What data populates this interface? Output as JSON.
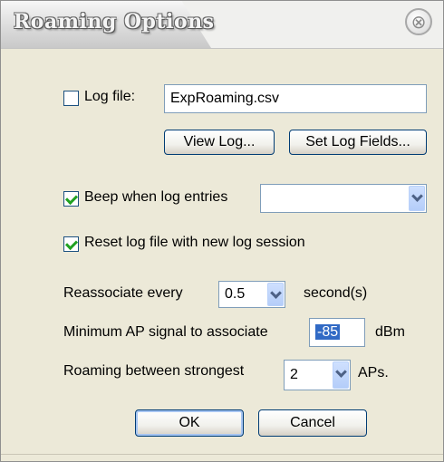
{
  "window": {
    "title": "Roaming Options",
    "close_glyph": "⊗"
  },
  "log": {
    "log_file_label": "Log file:",
    "log_file_checked": false,
    "log_file_value": "ExpRoaming.csv",
    "view_log_label": "View Log...",
    "set_log_fields_label": "Set Log Fields..."
  },
  "beep": {
    "label": "Beep when log entries",
    "checked": true,
    "selected": ""
  },
  "reset": {
    "label": "Reset log file with new log session",
    "checked": true
  },
  "reassociate": {
    "label": "Reassociate every",
    "value": "0.5",
    "unit": "second(s)"
  },
  "min_signal": {
    "label": "Minimum AP signal to associate",
    "value": "-85",
    "unit": "dBm"
  },
  "roaming": {
    "label": "Roaming between strongest",
    "value": "2",
    "unit": "APs."
  },
  "buttons": {
    "ok": "OK",
    "cancel": "Cancel"
  },
  "colors": {
    "dialog_bg": "#ece9d8",
    "check_green": "#21a121",
    "selection_blue": "#316ac5"
  }
}
